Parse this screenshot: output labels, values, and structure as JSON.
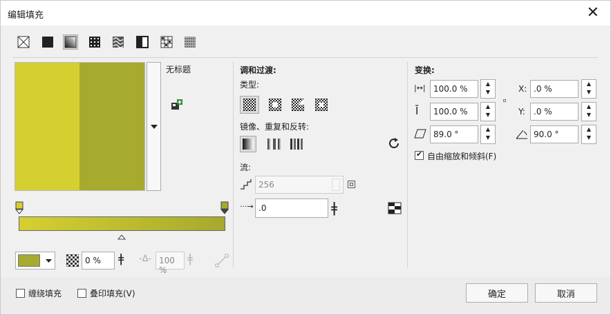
{
  "window": {
    "title": "编辑填充"
  },
  "toolbar": {
    "icons": [
      "no-fill-icon",
      "uniform-fill-icon",
      "fountain-fill-icon",
      "vector-pattern-fill-icon",
      "bitmap-pattern-fill-icon",
      "two-color-pattern-fill-icon",
      "texture-fill-icon",
      "postscript-fill-icon"
    ]
  },
  "preview": {
    "name_label": "无标题",
    "colors": {
      "left": "#d5cf31",
      "right": "#a6aa2e"
    }
  },
  "gradient": {
    "start_color": "#d5cf31",
    "end_color": "#a6aa2e"
  },
  "color_row": {
    "transparency_value": "0 %",
    "midpoint_value": "100 %"
  },
  "blend": {
    "heading": "调和过渡:",
    "type_label": "类型:",
    "mirror_label": "镜像、重复和反转:",
    "flow_label": "流:",
    "steps_value": "256",
    "acceleration_value": ".0"
  },
  "transform": {
    "heading": "变换:",
    "width_value": "100.0 %",
    "height_value": "100.0 %",
    "skew_value": "89.0 °",
    "x_label": "X:",
    "x_value": ".0 %",
    "y_label": "Y:",
    "y_value": ".0 %",
    "rotate_value": "90.0 °",
    "free_scale_label": "自由缩放和倾斜(F)",
    "free_scale_checked": true
  },
  "footer": {
    "wrap_label": "缠绕填充",
    "overprint_label": "叠印填充(V)",
    "ok_label": "确定",
    "cancel_label": "取消"
  }
}
